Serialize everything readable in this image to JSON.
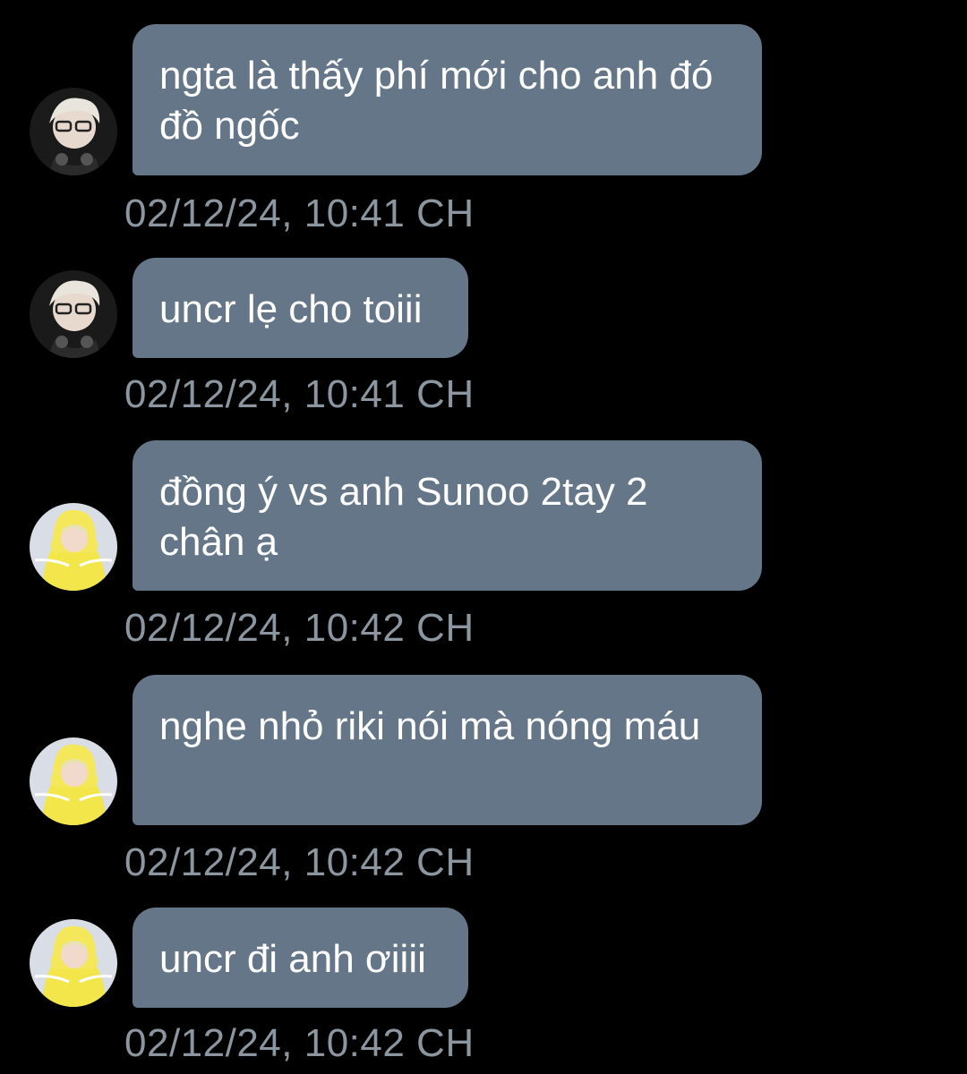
{
  "messages": [
    {
      "sender": "user-a",
      "text": "ngta là thấy phí mới cho anh đó đồ ngốc",
      "timestamp": "02/12/24, 10:41 CH"
    },
    {
      "sender": "user-a",
      "text": "uncr lẹ cho toiii",
      "timestamp": "02/12/24, 10:41 CH"
    },
    {
      "sender": "user-b",
      "text": "đồng ý vs anh Sunoo 2tay 2 chân ạ",
      "timestamp": "02/12/24, 10:42 CH"
    },
    {
      "sender": "user-b",
      "text": "nghe nhỏ riki nói mà nóng máu",
      "timestamp": "02/12/24, 10:42 CH"
    },
    {
      "sender": "user-b",
      "text": "uncr đi anh ơiiii",
      "timestamp": "02/12/24, 10:42 CH"
    }
  ],
  "colors": {
    "background": "#000000",
    "bubble": "#647687",
    "text": "#ffffff",
    "timestamp": "#8c96a0"
  }
}
